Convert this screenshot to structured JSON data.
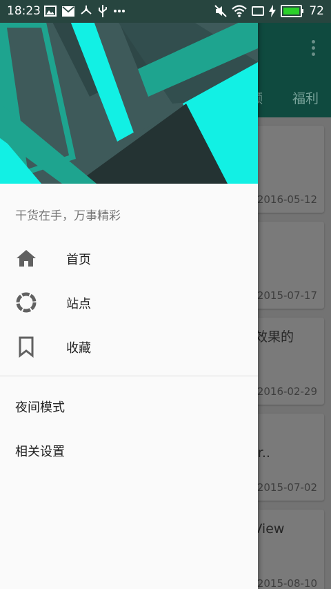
{
  "status_bar": {
    "time": "18:23",
    "battery": "72",
    "left_icons": [
      "image-icon",
      "mail-icon",
      "share-icon",
      "usb-icon",
      "more-dots-icon"
    ],
    "right_icons": [
      "mute-icon",
      "wifi-icon",
      "screen-rotate-icon",
      "charging-icon",
      "battery-icon"
    ]
  },
  "background": {
    "tabs": [
      "频",
      "福利"
    ],
    "cards": [
      {
        "title": "",
        "date": "2016-05-12"
      },
      {
        "title": "",
        "date": "2015-07-17"
      },
      {
        "title": "置效果的",
        "date": "2016-02-29"
      },
      {
        "title": "w、\nder..",
        "date": "2015-07-02"
      },
      {
        "title": "stView",
        "date": "2015-08-10"
      }
    ]
  },
  "drawer": {
    "tagline": "干货在手，万事精彩",
    "nav_items": [
      {
        "label": "首页",
        "icon": "home-icon"
      },
      {
        "label": "站点",
        "icon": "loading-ring-icon"
      },
      {
        "label": "收藏",
        "icon": "bookmark-icon"
      }
    ],
    "extra_items": [
      {
        "label": "夜间模式"
      },
      {
        "label": "相关设置"
      }
    ]
  },
  "colors": {
    "primary_dark": "#0f4a3f",
    "status_bar": "#27453f",
    "accent_cyan": "#12f0e4",
    "teal": "#1ea48f",
    "dark_slate": "#3e5a5a",
    "battery_green": "#2bd12b"
  }
}
